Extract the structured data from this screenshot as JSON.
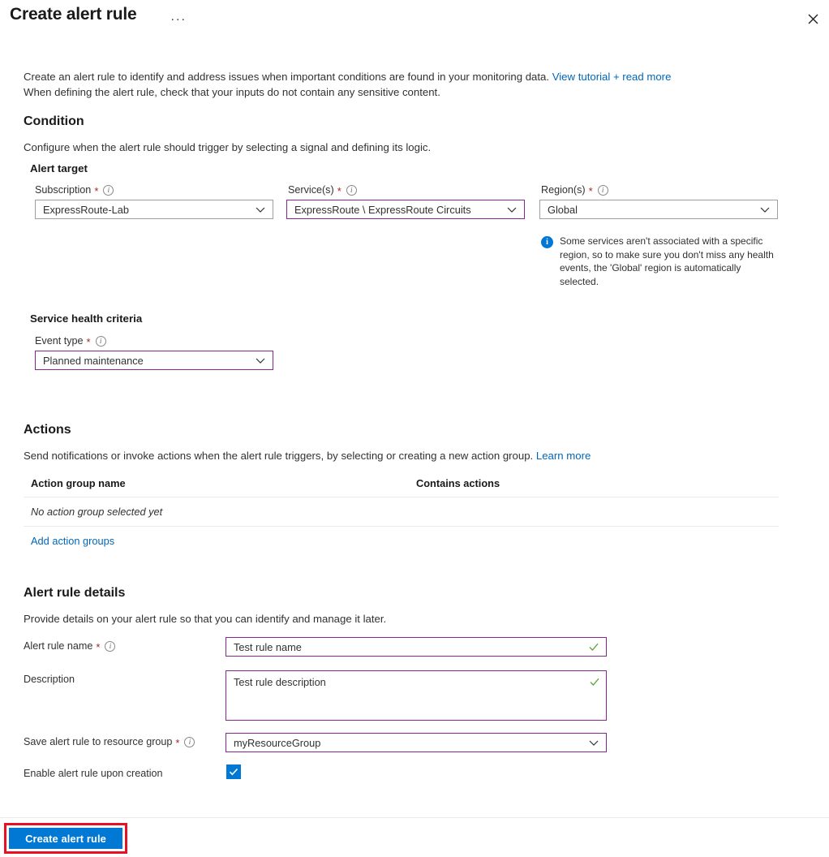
{
  "header": {
    "title": "Create alert rule",
    "more_label": "···",
    "close_label": "close-icon"
  },
  "intro": {
    "line1_before": "Create an alert rule to identify and address issues when important conditions are found in your monitoring data. ",
    "link": "View tutorial + read more",
    "line2": "When defining the alert rule, check that your inputs do not contain any sensitive content."
  },
  "condition": {
    "title": "Condition",
    "description": "Configure when the alert rule should trigger by selecting a signal and defining its logic.",
    "alert_target_title": "Alert target",
    "subscription": {
      "label": "Subscription",
      "required": "*",
      "value": "ExpressRoute-Lab"
    },
    "services": {
      "label": "Service(s)",
      "required": "*",
      "value": "ExpressRoute \\ ExpressRoute Circuits"
    },
    "regions": {
      "label": "Region(s)",
      "required": "*",
      "value": "Global"
    },
    "region_note": "Some services aren't associated with a specific region, so to make sure you don't miss any health events, the 'Global' region is automatically selected.",
    "service_health_title": "Service health criteria",
    "event_type": {
      "label": "Event type",
      "required": "*",
      "value": "Planned maintenance"
    }
  },
  "actions": {
    "title": "Actions",
    "description_before": "Send notifications or invoke actions when the alert rule triggers, by selecting or creating a new action group. ",
    "learn_more": "Learn more",
    "columns": [
      "Action group name",
      "Contains actions"
    ],
    "empty_row": "No action group selected yet",
    "add_link": "Add action groups"
  },
  "alert_rule_details": {
    "title": "Alert rule details",
    "description": "Provide details on your alert rule so that you can identify and manage it later.",
    "rule_name": {
      "label": "Alert rule name",
      "required": "*",
      "value": "Test rule name"
    },
    "description_field": {
      "label": "Description",
      "value": "Test rule description"
    },
    "resource_group": {
      "label": "Save alert rule to resource group",
      "required": "*",
      "value": "myResourceGroup"
    },
    "enable_rule": {
      "label": "Enable alert rule upon creation",
      "checked": "✓"
    }
  },
  "footer": {
    "create_button": "Create alert rule"
  },
  "colors": {
    "accent_blue": "#0078d4",
    "link_blue": "#0067b8",
    "purple_border": "#86268f",
    "required_red": "#a4262c",
    "valid_green": "#5ea33a",
    "highlight_red": "#e81123"
  }
}
